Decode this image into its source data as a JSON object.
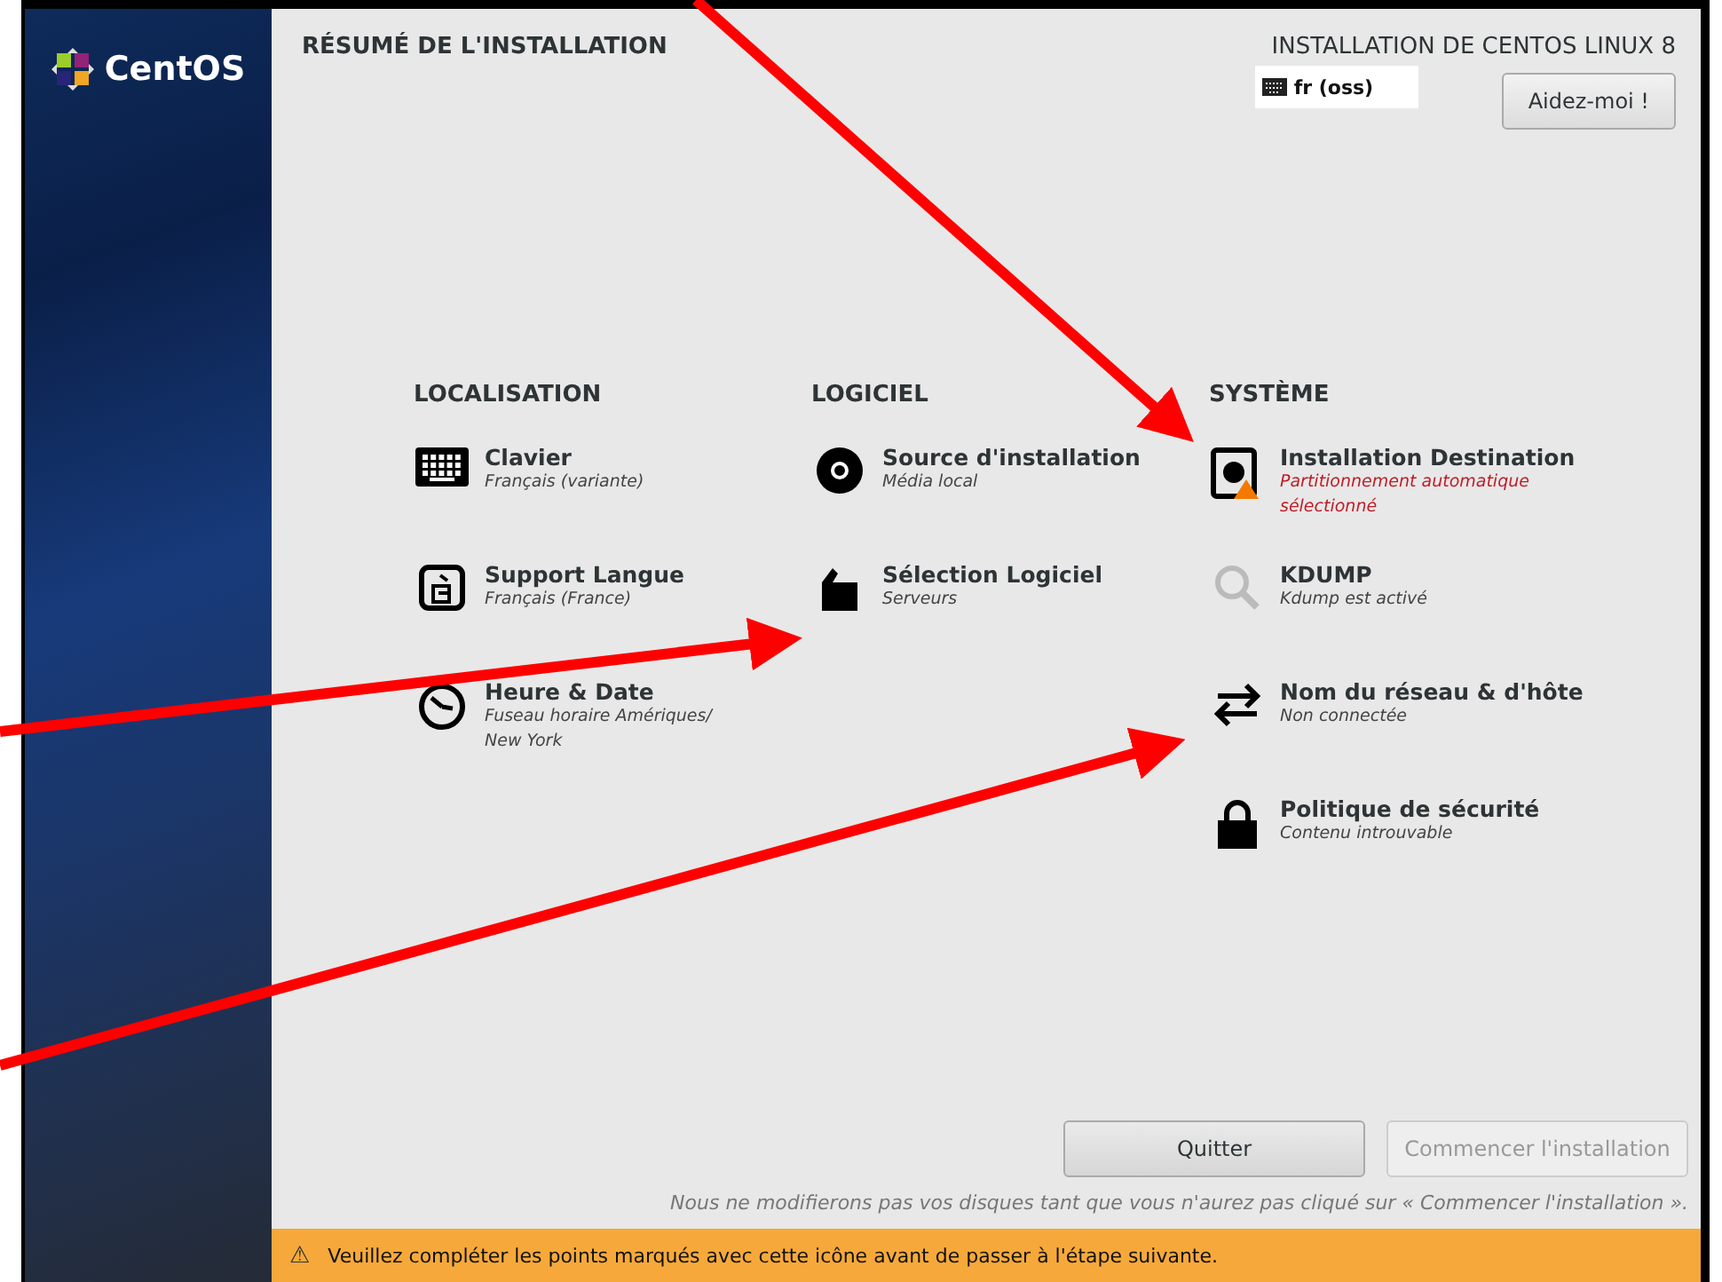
{
  "sidebar": {
    "logo_text": "CentOS"
  },
  "header": {
    "title": "RÉSUMÉ DE L'INSTALLATION",
    "product": "INSTALLATION DE CENTOS LINUX 8",
    "keyboard_layout": "fr (oss)",
    "help_button": "Aidez-moi !"
  },
  "sections": [
    {
      "heading": "LOCALISATION",
      "items": [
        {
          "title": "Clavier",
          "status": "Français (variante)",
          "warning": false
        },
        {
          "title": "Support Langue",
          "status": "Français (France)",
          "warning": false
        },
        {
          "title": "Heure & Date",
          "status": "Fuseau horaire Amériques/ New York",
          "warning": false
        }
      ]
    },
    {
      "heading": "LOGICIEL",
      "items": [
        {
          "title": "Source d'installation",
          "status": "Média local",
          "warning": false
        },
        {
          "title": "Sélection Logiciel",
          "status": "Serveurs",
          "warning": false
        }
      ]
    },
    {
      "heading": "SYSTÈME",
      "items": [
        {
          "title": "Installation Destination",
          "status": "Partitionnement automatique sélectionné",
          "warning": true
        },
        {
          "title": "KDUMP",
          "status": "Kdump est activé",
          "warning": false
        },
        {
          "title": "Nom du réseau & d'hôte",
          "status": "Non connectée",
          "warning": false
        },
        {
          "title": "Politique de sécurité",
          "status": "Contenu introuvable",
          "warning": false
        }
      ]
    }
  ],
  "buttons": [
    {
      "label": "Quitter",
      "disabled": false
    },
    {
      "label": "Commencer l'installation",
      "disabled": true
    }
  ],
  "note": "Nous ne modifierons pas vos disques tant que vous n'aurez pas cliqué sur « Commencer l'installation ».",
  "warning_bar": {
    "icon": "⚠",
    "text": "Veuillez compléter les points marqués avec cette icône avant de passer à l'étape suivante."
  }
}
